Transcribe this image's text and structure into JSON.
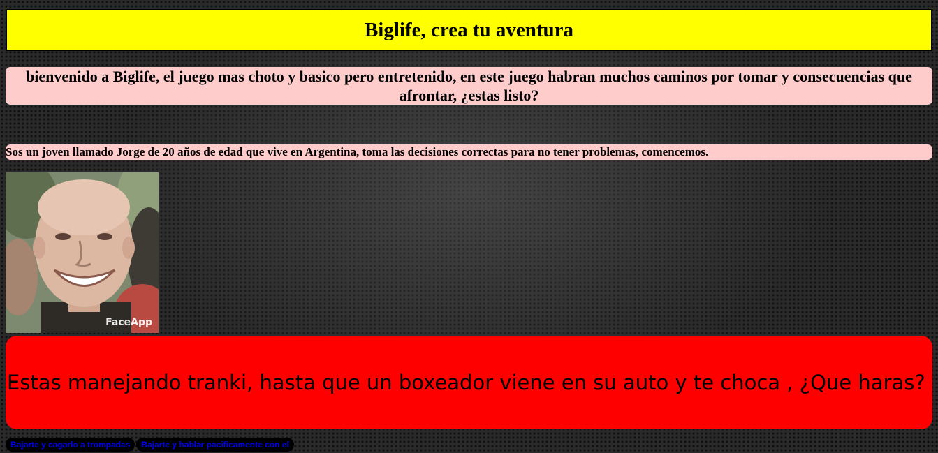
{
  "header": {
    "title": "Biglife, crea tu aventura"
  },
  "welcome": {
    "text": "bienvenido a Biglife, el juego mas choto y basico pero entretenido, en este juego habran muchos caminos por tomar y consecuencias que afrontar, ¿estas listo?"
  },
  "intro": {
    "text": "Sos un joven llamado Jorge de 20 años de edad que vive en Argentina, toma las decisiones correctas para no tener problemas, comencemos."
  },
  "photo": {
    "watermark": "FaceApp"
  },
  "scene": {
    "text": "Estas manejando tranki, hasta que un boxeador viene en su auto y te choca , ¿Que haras?"
  },
  "options": [
    {
      "label": "Bajarte y cagarlo a trompadas"
    },
    {
      "label": "Bajarte y hablar pacificamente con el"
    }
  ],
  "colors": {
    "title_bg": "#ffff00",
    "text_box_bg": "#ffcccc",
    "scene_bg": "#ff0000",
    "option_bg": "#000000",
    "option_text": "#0000ee"
  }
}
